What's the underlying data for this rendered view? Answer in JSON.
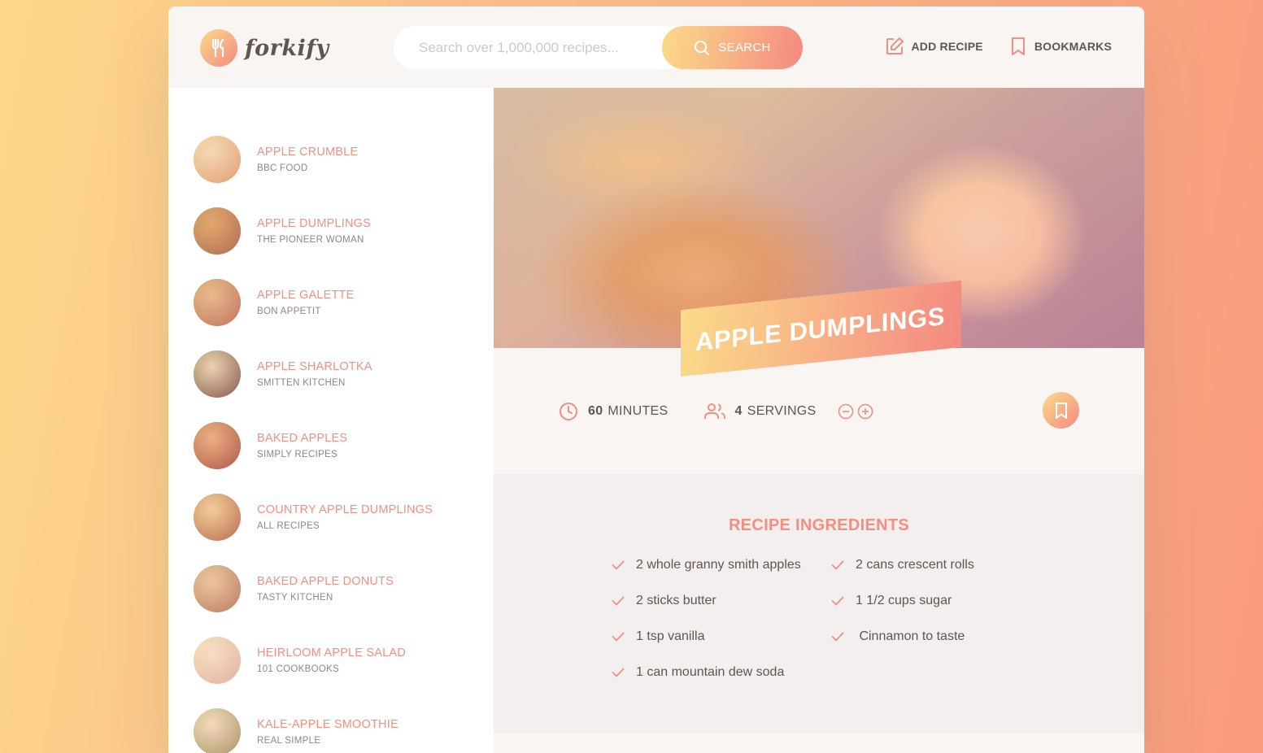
{
  "app": {
    "name": "forkify"
  },
  "search": {
    "placeholder": "Search over 1,000,000 recipes...",
    "button_label": "SEARCH"
  },
  "nav": {
    "add_recipe": "ADD RECIPE",
    "bookmarks": "BOOKMARKS"
  },
  "results": [
    {
      "title": "APPLE CRUMBLE",
      "publisher": "BBC FOOD",
      "thumb": [
        "#f3e5cf",
        "#d9a56c"
      ]
    },
    {
      "title": "APPLE DUMPLINGS",
      "publisher": "THE PIONEER WOMAN",
      "thumb": [
        "#d99a5e",
        "#8b5a3c"
      ]
    },
    {
      "title": "APPLE GALETTE",
      "publisher": "BON APPETIT",
      "thumb": [
        "#e0b78f",
        "#a8654a"
      ]
    },
    {
      "title": "APPLE SHARLOTKA",
      "publisher": "SMITTEN KITCHEN",
      "thumb": [
        "#e8dcc6",
        "#4a3a36"
      ]
    },
    {
      "title": "BAKED APPLES",
      "publisher": "SIMPLY RECIPES",
      "thumb": [
        "#e6a57f",
        "#8c3b2f"
      ]
    },
    {
      "title": "COUNTRY APPLE DUMPLINGS",
      "publisher": "ALL RECIPES",
      "thumb": [
        "#f0d3a6",
        "#9c5a35"
      ]
    },
    {
      "title": "BAKED APPLE DONUTS",
      "publisher": "TASTY KITCHEN",
      "thumb": [
        "#e9c8a8",
        "#9c7156"
      ]
    },
    {
      "title": "HEIRLOOM APPLE SALAD",
      "publisher": "101 COOKBOOKS",
      "thumb": [
        "#f5ece2",
        "#dac4b0"
      ]
    },
    {
      "title": "KALE-APPLE SMOOTHIE",
      "publisher": "REAL SIMPLE",
      "thumb": [
        "#f6e4d8",
        "#7c9a5a"
      ]
    }
  ],
  "recipe": {
    "title": "APPLE DUMPLINGS",
    "cooking_time": "60",
    "cooking_time_unit": "MINUTES",
    "servings": "4",
    "servings_unit": "SERVINGS",
    "ingredients_heading": "RECIPE INGREDIENTS",
    "ingredients": [
      "2 whole granny smith apples",
      "2 cans crescent rolls",
      "2 sticks butter",
      "1 1/2 cups sugar",
      "1 tsp vanilla",
      " Cinnamon to taste",
      "1 can mountain dew soda"
    ]
  },
  "colors": {
    "accent": "#f38e82",
    "gradient_start": "#fbdb89",
    "gradient_end": "#f48982",
    "text": "#615551"
  },
  "icons": {
    "logo": "fork-knife-icon",
    "search": "search-icon",
    "add_recipe": "edit-icon",
    "bookmarks": "bookmark-icon",
    "time": "clock-icon",
    "servings": "users-icon",
    "decrease": "minus-circle-icon",
    "increase": "plus-circle-icon",
    "ingredient": "check-icon"
  }
}
